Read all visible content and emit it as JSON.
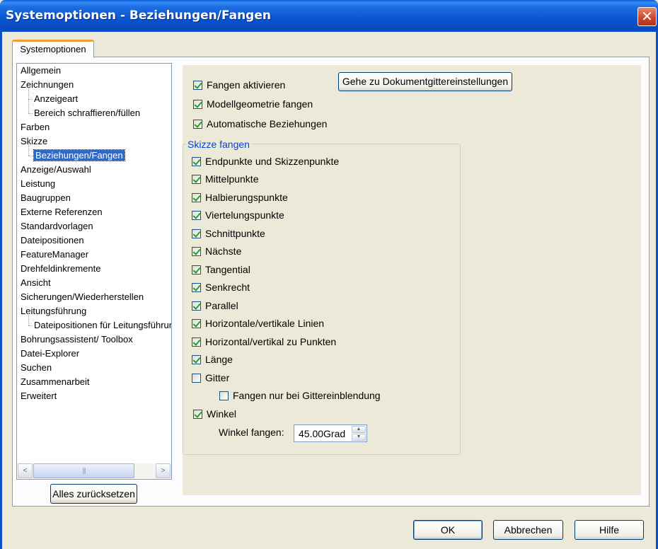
{
  "window": {
    "title": "Systemoptionen - Beziehungen/Fangen",
    "close_glyph": "✕"
  },
  "tab": {
    "label": "Systemoptionen"
  },
  "tree": {
    "items": [
      {
        "label": "Allgemein",
        "level": 0
      },
      {
        "label": "Zeichnungen",
        "level": 0
      },
      {
        "label": "Anzeigeart",
        "level": 1
      },
      {
        "label": "Bereich schraffieren/füllen",
        "level": 1
      },
      {
        "label": "Farben",
        "level": 0
      },
      {
        "label": "Skizze",
        "level": 0
      },
      {
        "label": "Beziehungen/Fangen",
        "level": 1,
        "selected": true
      },
      {
        "label": "Anzeige/Auswahl",
        "level": 0
      },
      {
        "label": "Leistung",
        "level": 0
      },
      {
        "label": "Baugruppen",
        "level": 0
      },
      {
        "label": "Externe Referenzen",
        "level": 0
      },
      {
        "label": "Standardvorlagen",
        "level": 0
      },
      {
        "label": "Dateipositionen",
        "level": 0
      },
      {
        "label": "FeatureManager",
        "level": 0
      },
      {
        "label": "Drehfeldinkremente",
        "level": 0
      },
      {
        "label": "Ansicht",
        "level": 0
      },
      {
        "label": "Sicherungen/Wiederherstellen",
        "level": 0
      },
      {
        "label": "Leitungsführung",
        "level": 0
      },
      {
        "label": "Dateipositionen für Leitungsführung",
        "level": 1
      },
      {
        "label": "Bohrungsassistent/ Toolbox",
        "level": 0
      },
      {
        "label": "Datei-Explorer",
        "level": 0
      },
      {
        "label": "Suchen",
        "level": 0
      },
      {
        "label": "Zusammenarbeit",
        "level": 0
      },
      {
        "label": "Erweitert",
        "level": 0
      }
    ],
    "scroll_left_glyph": "<",
    "scroll_right_glyph": ">",
    "scroll_grip": "|||"
  },
  "reset_button": "Alles zurücksetzen",
  "goto_grid_button": "Gehe zu Dokumentgittereinstellungen",
  "top_options": [
    {
      "label": "Fangen aktivieren",
      "checked": true
    },
    {
      "label": "Modellgeometrie fangen",
      "checked": true
    },
    {
      "label": "Automatische Beziehungen",
      "checked": true
    }
  ],
  "snap_group": {
    "legend": "Skizze fangen",
    "options": [
      {
        "label": "Endpunkte und Skizzenpunkte",
        "checked": true
      },
      {
        "label": "Mittelpunkte",
        "checked": true
      },
      {
        "label": "Halbierungspunkte",
        "checked": true
      },
      {
        "label": "Viertelungspunkte",
        "checked": true
      },
      {
        "label": "Schnittpunkte",
        "checked": true
      },
      {
        "label": "Nächste",
        "checked": true
      },
      {
        "label": "Tangential",
        "checked": true
      },
      {
        "label": "Senkrecht",
        "checked": true
      },
      {
        "label": "Parallel",
        "checked": true
      },
      {
        "label": "Horizontale/vertikale Linien",
        "checked": true
      },
      {
        "label": "Horizontal/vertikal zu Punkten",
        "checked": true
      },
      {
        "label": "Länge",
        "checked": true
      },
      {
        "label": "Gitter",
        "checked": false
      }
    ],
    "grid_only": {
      "label": "Fangen nur bei Gittereinblendung",
      "checked": false
    },
    "angle": {
      "label": "Winkel",
      "checked": true
    },
    "angle_snap_label": "Winkel fangen:",
    "angle_snap_value": "45.00Grad"
  },
  "footer": {
    "ok": "OK",
    "cancel": "Abbrechen",
    "help": "Hilfe"
  }
}
